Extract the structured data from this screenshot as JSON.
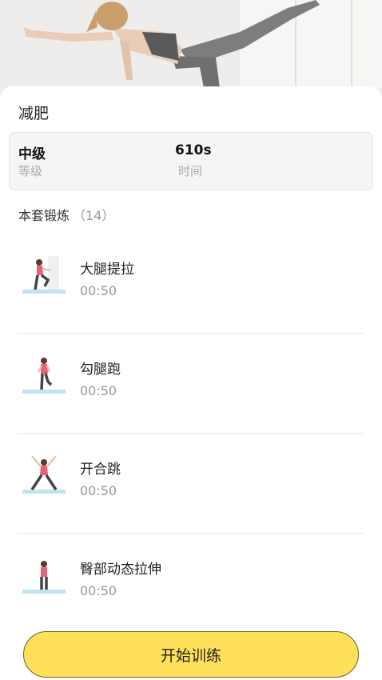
{
  "plan": {
    "title": "减肥",
    "level_value": "中级",
    "level_label": "等级",
    "duration_value": "610s",
    "duration_label": "时间"
  },
  "section": {
    "title": "本套锻炼",
    "count": "（14）"
  },
  "exercises": [
    {
      "name": "大腿提拉",
      "duration": "00:50"
    },
    {
      "name": "勾腿跑",
      "duration": "00:50"
    },
    {
      "name": "开合跳",
      "duration": "00:50"
    },
    {
      "name": "臀部动态拉伸",
      "duration": "00:50"
    }
  ],
  "start_button": {
    "label": "开始训练"
  },
  "colors": {
    "accent": "#fee05a",
    "mat": "#bfe3f2",
    "figure_top": "#e8607a",
    "figure_pants": "#444444"
  },
  "icons": {
    "hero": "woman-yoga-photo",
    "exercise_thumbs": [
      "thigh-lift-figure-icon",
      "butt-kick-run-figure-icon",
      "jumping-jack-figure-icon",
      "glute-stretch-figure-icon"
    ]
  }
}
